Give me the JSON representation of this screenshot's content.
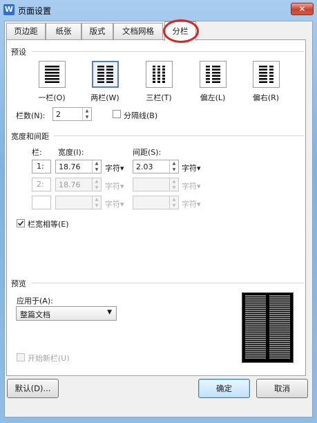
{
  "window": {
    "title": "页面设置",
    "app_icon": "W"
  },
  "tabs": [
    {
      "label": "页边距",
      "active": false
    },
    {
      "label": "纸张",
      "active": false
    },
    {
      "label": "版式",
      "active": false
    },
    {
      "label": "文档网格",
      "active": false
    },
    {
      "label": "分栏",
      "active": true
    }
  ],
  "presets": {
    "group_label": "预设",
    "items": [
      {
        "label": "一栏(O)",
        "columns": 1,
        "selected": false
      },
      {
        "label": "两栏(W)",
        "columns": 2,
        "selected": true
      },
      {
        "label": "三栏(T)",
        "columns": 3,
        "selected": false
      },
      {
        "label": "偏左(L)",
        "columns": 2,
        "selected": false
      },
      {
        "label": "偏右(R)",
        "columns": 2,
        "selected": false
      }
    ]
  },
  "column_count": {
    "label": "栏数(N):",
    "value": "2"
  },
  "divider": {
    "label": "分隔线(B)",
    "checked": false
  },
  "width_spacing": {
    "group_label": "宽度和间距",
    "col_header": "栏:",
    "width_header": "宽度(I):",
    "spacing_header": "间距(S):",
    "rows": [
      {
        "index": "1:",
        "width": "18.76",
        "width_unit": "字符",
        "spacing": "2.03",
        "spacing_unit": "字符",
        "enabled": true
      },
      {
        "index": "2:",
        "width": "18.76",
        "width_unit": "字符",
        "spacing": "",
        "spacing_unit": "字符",
        "enabled": false
      },
      {
        "index": "",
        "width": "",
        "width_unit": "字符",
        "spacing": "",
        "spacing_unit": "字符",
        "enabled": false
      }
    ],
    "equal_width": {
      "label": "栏宽相等(E)",
      "checked": true
    }
  },
  "preview": {
    "group_label": "预览",
    "apply_label": "应用于(A):",
    "apply_value": "整篇文档",
    "new_column": {
      "label": "开始新栏(U)",
      "checked": false,
      "enabled": false
    }
  },
  "buttons": {
    "default": "默认(D)...",
    "ok": "确定",
    "cancel": "取消"
  }
}
